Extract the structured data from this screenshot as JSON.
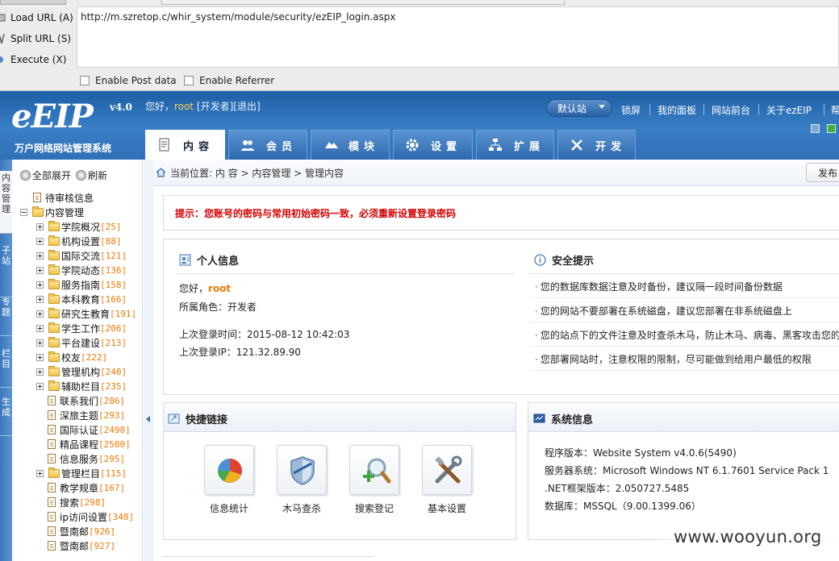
{
  "hackbar": {
    "load_url": "Load URL (A)",
    "split_url": "Split URL (S)",
    "execute": "Execute (X)",
    "url_value": "http://m.szretop.c/whir_system/module/security/ezEIP_login.aspx",
    "enable_post": "Enable Post data",
    "enable_referrer": "Enable Referrer"
  },
  "header": {
    "logo_main": "eEIP",
    "logo_version": "v4.0",
    "logo_subtitle": "万户网络网站管理系统",
    "greeting_prefix": "您好，",
    "username": "root",
    "role_link": "[开发者]",
    "logout_link": "[退出]",
    "theme_select": "默认站",
    "top_links": [
      "锁屏",
      "我的面板",
      "网站前台",
      "关于ezEIP",
      "帮"
    ],
    "tabs": [
      {
        "label": "内容",
        "active": true
      },
      {
        "label": "会员",
        "active": false
      },
      {
        "label": "模块",
        "active": false
      },
      {
        "label": "设置",
        "active": false
      },
      {
        "label": "扩展",
        "active": false
      },
      {
        "label": "开发",
        "active": false
      }
    ]
  },
  "edge": [
    "内容管理",
    "子站",
    "专题",
    "栏目",
    "生成"
  ],
  "tree": {
    "expand_all": "全部展开",
    "refresh": "刷新",
    "nodes": [
      {
        "label": "待审核信息",
        "count": "",
        "type": "page",
        "level": 0
      },
      {
        "label": "内容管理",
        "count": "",
        "type": "root",
        "level": 0
      },
      {
        "label": "学院概况",
        "count": "[25]",
        "type": "folder",
        "level": 1
      },
      {
        "label": "机构设置",
        "count": "[88]",
        "type": "folder",
        "level": 1
      },
      {
        "label": "国际交流",
        "count": "[121]",
        "type": "folder",
        "level": 1
      },
      {
        "label": "学院动态",
        "count": "[136]",
        "type": "folder",
        "level": 1
      },
      {
        "label": "服务指南",
        "count": "[158]",
        "type": "folder",
        "level": 1
      },
      {
        "label": "本科教育",
        "count": "[166]",
        "type": "folder",
        "level": 1
      },
      {
        "label": "研究生教育",
        "count": "[191]",
        "type": "folder",
        "level": 1
      },
      {
        "label": "学生工作",
        "count": "[206]",
        "type": "folder",
        "level": 1
      },
      {
        "label": "平台建设",
        "count": "[213]",
        "type": "folder",
        "level": 1
      },
      {
        "label": "校友",
        "count": "[222]",
        "type": "folder",
        "level": 1
      },
      {
        "label": "管理机构",
        "count": "[240]",
        "type": "folder",
        "level": 1
      },
      {
        "label": "辅助栏目",
        "count": "[235]",
        "type": "folder",
        "level": 1
      },
      {
        "label": "联系我们",
        "count": "[286]",
        "type": "page",
        "level": 2
      },
      {
        "label": "深旅主题",
        "count": "[293]",
        "type": "page",
        "level": 2
      },
      {
        "label": "国际认证",
        "count": "[2498]",
        "type": "page",
        "level": 2
      },
      {
        "label": "精品课程",
        "count": "[2500]",
        "type": "page",
        "level": 2
      },
      {
        "label": "信息服务",
        "count": "[295]",
        "type": "page",
        "level": 2
      },
      {
        "label": "管理栏目",
        "count": "[115]",
        "type": "folder",
        "level": 1
      },
      {
        "label": "教学规章",
        "count": "[167]",
        "type": "page",
        "level": 2
      },
      {
        "label": "搜索",
        "count": "[298]",
        "type": "page",
        "level": 2
      },
      {
        "label": "ip访问设置",
        "count": "[348]",
        "type": "page",
        "level": 2
      },
      {
        "label": "暨南邮",
        "count": "[926]",
        "type": "page",
        "level": 2
      },
      {
        "label": "暨南邮",
        "count": "[927]",
        "type": "page",
        "level": 2
      }
    ]
  },
  "breadcrumb": "当前位置: 内 容 > 内容管理 > 管理内容",
  "publish_button": "发布",
  "notice": "提示：您账号的密码与常用初始密码一致，必须重新设置登录密码",
  "personal": {
    "title": "个人信息",
    "greeting": "您好，",
    "username": "root",
    "role": "所属角色：开发者",
    "last_login_time": "上次登录时间：2015-08-12 10:42:03",
    "last_login_ip": "上次登录IP：121.32.89.90"
  },
  "security": {
    "title": "安全提示",
    "tips": [
      "您的数据库数据注意及时备份，建议隔一段时间备份数据",
      "您的网站不要部署在系统磁盘，建议您部署在非系统磁盘上",
      "您的站点下的文件注意及时查杀木马，防止木马、病毒、黑客攻击您的",
      "您部署网站时，注意权限的限制，尽可能做到给用户最低的权限"
    ]
  },
  "quick_links": {
    "title": "快捷链接",
    "items": [
      "信息统计",
      "木马查杀",
      "搜索登记",
      "基本设置"
    ]
  },
  "system_info": {
    "title": "系统信息",
    "lines": [
      "程序版本：Website System v4.0.6(5490)",
      "服务器系统：Microsoft Windows NT 6.1.7601 Service Pack 1",
      ".NET框架版本：2.050727.5485",
      "数据库：MSSQL（9.00.1399.06）"
    ]
  },
  "watermark": "www.wooyun.org",
  "colors": {
    "header_blue": "#2f6fb6",
    "notice_red": "#d40000",
    "count_orange": "#f07800"
  }
}
